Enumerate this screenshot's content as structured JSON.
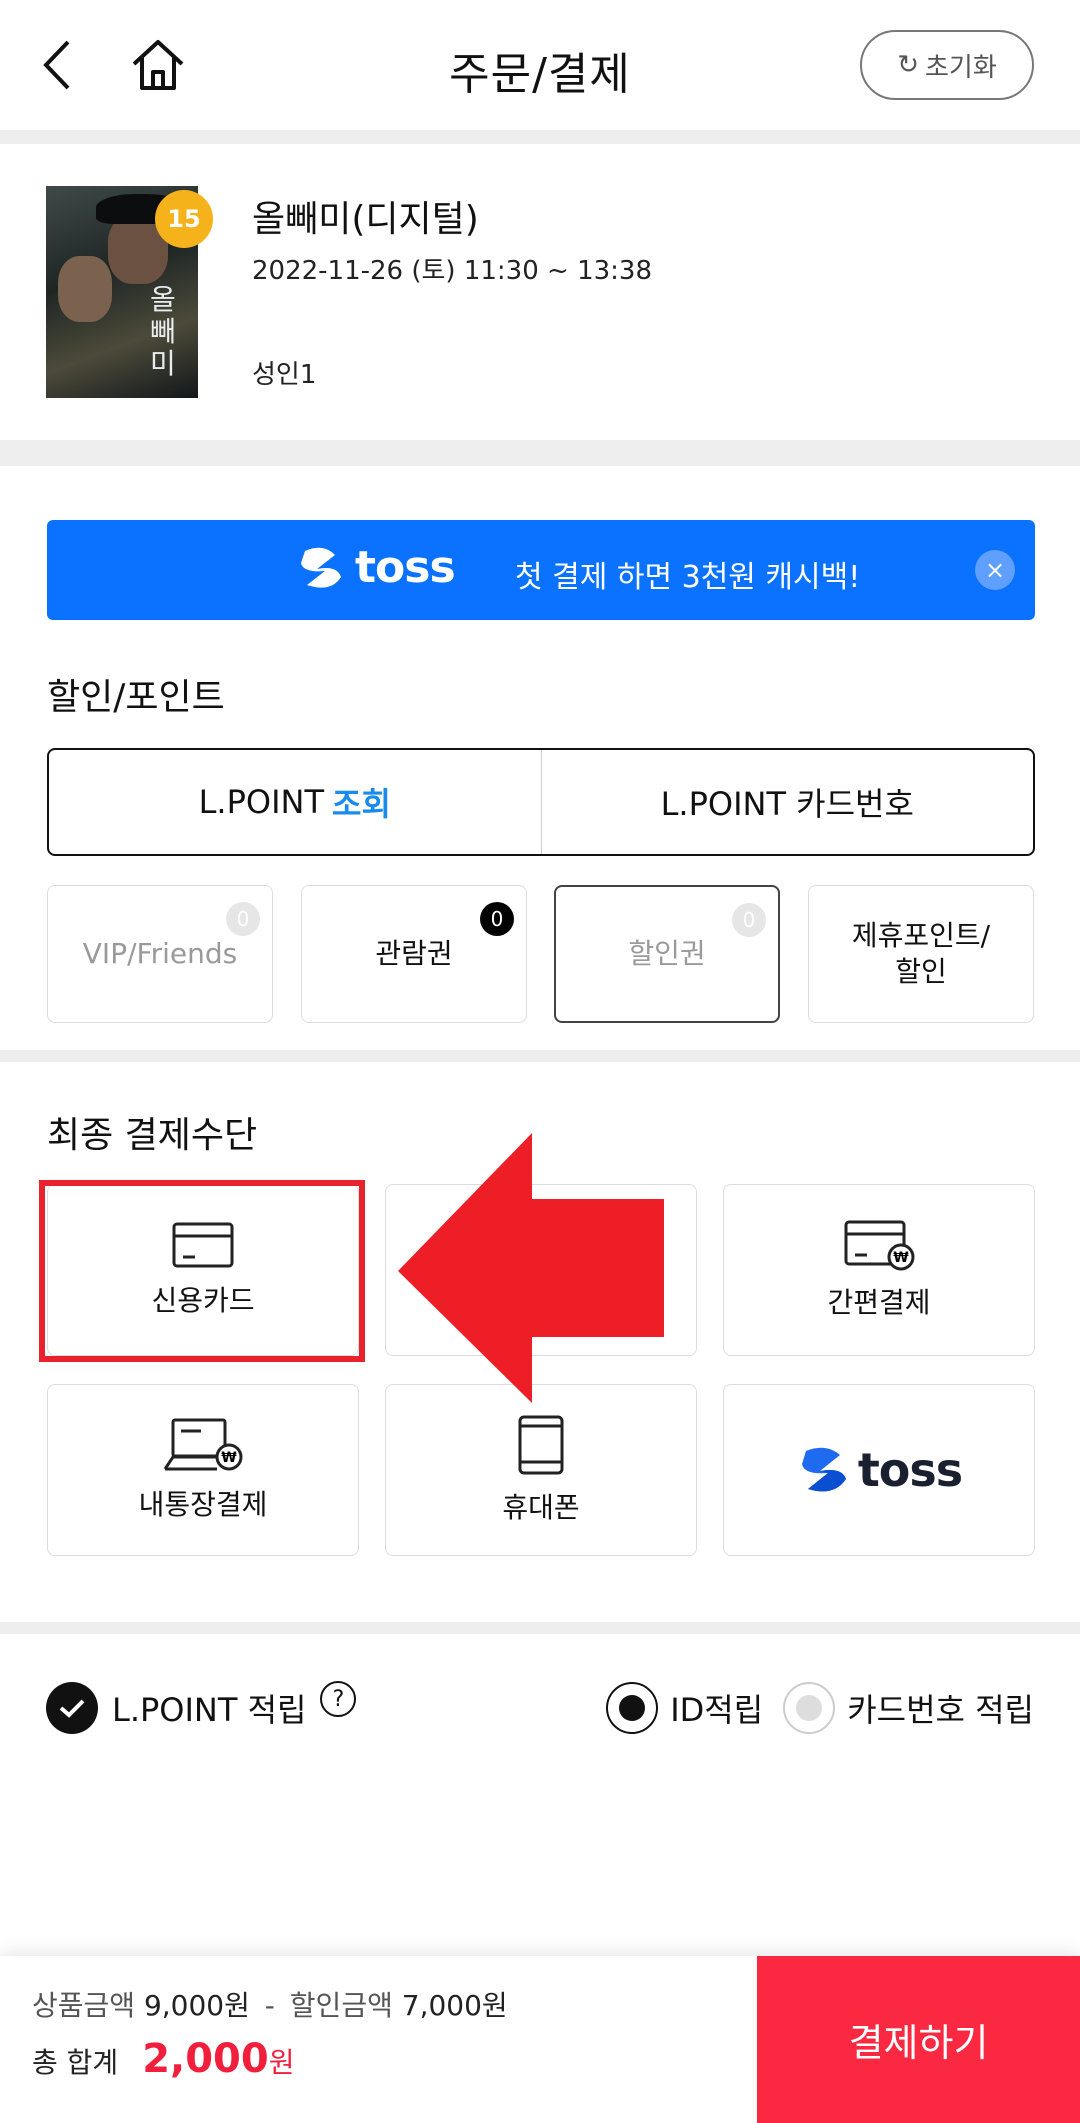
{
  "header": {
    "title": "주문/결제",
    "reset_label": "초기화"
  },
  "movie": {
    "age_rating": "15",
    "poster_title": "올빼미",
    "title": "올빼미(디지털)",
    "datetime": "2022-11-26 (토) 11:30 ~ 13:38",
    "people": "성인1"
  },
  "banner": {
    "brand": "toss",
    "message": "첫 결제 하면 3천원 캐시백!",
    "close_label": "×",
    "color": "#0a72ff"
  },
  "discount": {
    "section_title": "할인/포인트",
    "lpoint_tabs": [
      {
        "label": "L.POINT",
        "highlight": "조회"
      },
      {
        "label": "L.POINT 카드번호",
        "highlight": ""
      }
    ],
    "options": [
      {
        "label": "VIP/Friends",
        "count": "0",
        "state": "disabled"
      },
      {
        "label": "관람권",
        "count": "0",
        "state": "active"
      },
      {
        "label": "할인권",
        "count": "0",
        "state": "disabled"
      },
      {
        "label": "제휴포인트/\n할인",
        "count": "",
        "state": "normal"
      }
    ]
  },
  "payment": {
    "section_title": "최종 결제수단",
    "methods": [
      {
        "label": "신용카드",
        "icon": "credit-card-icon"
      },
      {
        "label": "",
        "icon": ""
      },
      {
        "label": "간편결제",
        "icon": "easy-pay-card-icon"
      },
      {
        "label": "내통장결제",
        "icon": "bank-account-icon"
      },
      {
        "label": "휴대폰",
        "icon": "mobile-phone-icon"
      },
      {
        "label": "toss",
        "icon": "toss-logo-icon"
      }
    ],
    "annotation_color": "#e8232e"
  },
  "accrual": {
    "label": "L.POINT 적립",
    "help": "?",
    "options": [
      "ID적립",
      "카드번호 적립"
    ],
    "selected": 0
  },
  "footer": {
    "product_label": "상품금액",
    "product_amount": "9,000원",
    "separator": "-",
    "discount_label": "할인금액",
    "discount_amount": "7,000원",
    "total_label": "총 합계",
    "total_amount": "2,000",
    "currency": "원",
    "pay_button": "결제하기",
    "accent": "#fa2841"
  }
}
